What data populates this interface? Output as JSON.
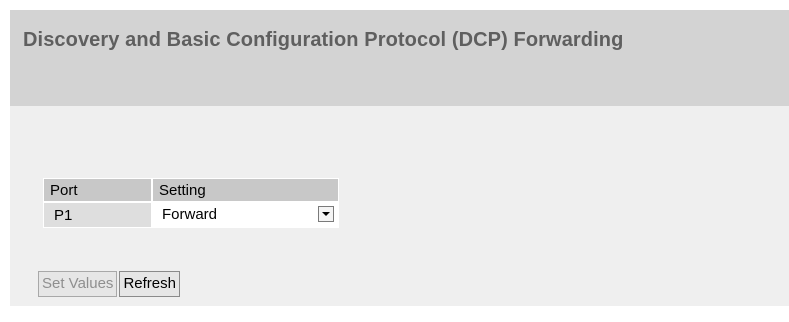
{
  "header": {
    "title": "Discovery and Basic Configuration Protocol (DCP) Forwarding"
  },
  "table": {
    "columns": [
      "Port",
      "Setting"
    ],
    "rows": [
      {
        "port": "P1",
        "setting": "Forward"
      }
    ]
  },
  "actions": {
    "set_values": "Set Values",
    "refresh": "Refresh",
    "set_values_enabled": false
  }
}
